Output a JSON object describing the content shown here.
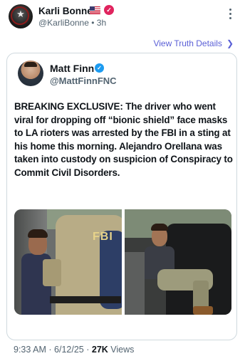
{
  "truth_post": {
    "author_name": "Karli Bonne’",
    "flag_icon": "us-flag-icon",
    "verified_icon": "verified-badge-icon",
    "handle": "@KarliBonne",
    "separator": "•",
    "time_ago": "3h",
    "more_icon": "vertical-ellipsis-icon",
    "view_link_label": "View Truth Details",
    "view_link_icon": "chevron-right-icon",
    "accent_color": "#5a5fd6"
  },
  "embedded_tweet": {
    "author_name": "Matt Finn",
    "verified_icon": "blue-check-icon",
    "handle": "@MattFinnFNC",
    "text": "BREAKING EXCLUSIVE:  The driver who went viral for dropping off “bionic shield” face masks to LA rioters was arrested by the FBI in a sting at his home this morning. Alejandro Orellana was taken into custody on suspicion of Conspiracy to Commit Civil Disorders.",
    "photo_left_label": "FBI",
    "time": "9:33 AM",
    "separator": "·",
    "date": "6/12/25",
    "views_count": "27K",
    "views_label": "Views"
  }
}
